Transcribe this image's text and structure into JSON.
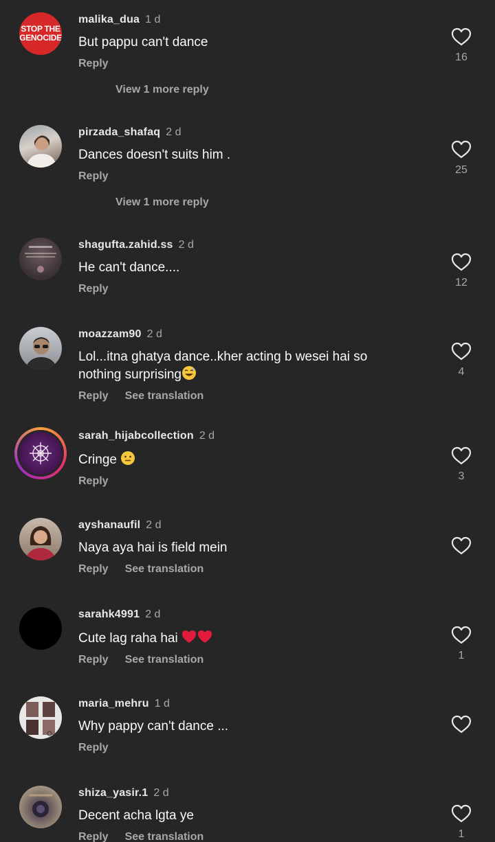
{
  "actions": {
    "reply": "Reply",
    "see_translation": "See translation"
  },
  "comments": [
    {
      "user": "malika_dua",
      "time": "1 d",
      "text": "But pappu can't dance",
      "likes": "16",
      "more": "View 1 more reply",
      "avatar_text_1": "STOP THE",
      "avatar_text_2": "GENOCIDE"
    },
    {
      "user": "pirzada_shafaq",
      "time": "2 d",
      "text": "Dances doesn't suits him .",
      "likes": "25",
      "more": "View 1 more reply"
    },
    {
      "user": "shagufta.zahid.ss",
      "time": "2 d",
      "text": "He can't dance....",
      "likes": "12"
    },
    {
      "user": "moazzam90",
      "time": "2 d",
      "text_line1": "Lol...itna ghatya dance..kher acting b wesei hai so",
      "text_line2": "nothing surprising",
      "likes": "4"
    },
    {
      "user": "sarah_hijabcollection",
      "time": "2 d",
      "text": "Cringe",
      "likes": "3"
    },
    {
      "user": "ayshanaufil",
      "time": "2 d",
      "text": "Naya aya hai is field mein",
      "likes": ""
    },
    {
      "user": "sarahk4991",
      "time": "2 d",
      "text": "Cute lag raha hai",
      "likes": "1"
    },
    {
      "user": "maria_mehru",
      "time": "1 d",
      "text": "Why pappy can't dance ...",
      "likes": ""
    },
    {
      "user": "shiza_yasir.1",
      "time": "2 d",
      "text": "Decent acha lgta ye",
      "likes": "1"
    }
  ],
  "colors": {
    "background": "#262626",
    "text": "#f5f5f5",
    "muted": "#a8a8a8",
    "heart_red": "#e0245e"
  }
}
